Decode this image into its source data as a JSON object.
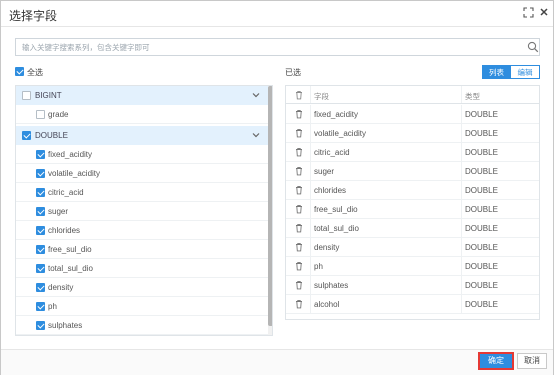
{
  "dialog": {
    "title": "选择字段"
  },
  "search": {
    "placeholder": "输入关键字搜索系列，包含关键字即可"
  },
  "left": {
    "select_all_label": "全选",
    "groups": [
      {
        "label": "BIGINT",
        "checked": false,
        "items": [
          {
            "label": "grade",
            "checked": false
          }
        ]
      },
      {
        "label": "DOUBLE",
        "checked": true,
        "items": [
          {
            "label": "fixed_acidity",
            "checked": true
          },
          {
            "label": "volatile_acidity",
            "checked": true
          },
          {
            "label": "citric_acid",
            "checked": true
          },
          {
            "label": "suger",
            "checked": true
          },
          {
            "label": "chlorides",
            "checked": true
          },
          {
            "label": "free_sul_dio",
            "checked": true
          },
          {
            "label": "total_sul_dio",
            "checked": true
          },
          {
            "label": "density",
            "checked": true
          },
          {
            "label": "ph",
            "checked": true
          },
          {
            "label": "sulphates",
            "checked": true
          }
        ]
      }
    ]
  },
  "right": {
    "selected_label": "已选",
    "view_list": "列表",
    "view_edit": "编辑",
    "col_field": "字段",
    "col_type": "类型",
    "rows": [
      {
        "field": "fixed_acidity",
        "type": "DOUBLE"
      },
      {
        "field": "volatile_acidity",
        "type": "DOUBLE"
      },
      {
        "field": "citric_acid",
        "type": "DOUBLE"
      },
      {
        "field": "suger",
        "type": "DOUBLE"
      },
      {
        "field": "chlorides",
        "type": "DOUBLE"
      },
      {
        "field": "free_sul_dio",
        "type": "DOUBLE"
      },
      {
        "field": "total_sul_dio",
        "type": "DOUBLE"
      },
      {
        "field": "density",
        "type": "DOUBLE"
      },
      {
        "field": "ph",
        "type": "DOUBLE"
      },
      {
        "field": "sulphates",
        "type": "DOUBLE"
      },
      {
        "field": "alcohol",
        "type": "DOUBLE"
      }
    ]
  },
  "footer": {
    "ok_label": "确定",
    "cancel_label": "取消"
  },
  "colors": {
    "accent": "#2e8ddf",
    "group_bg": "#e3f1fd",
    "highlight_border": "#e53935"
  },
  "icons": {
    "expand": "fullscreen-icon",
    "close": "close-icon",
    "search": "search-icon",
    "chevron": "chevron-down-icon",
    "delete": "trash-icon"
  }
}
